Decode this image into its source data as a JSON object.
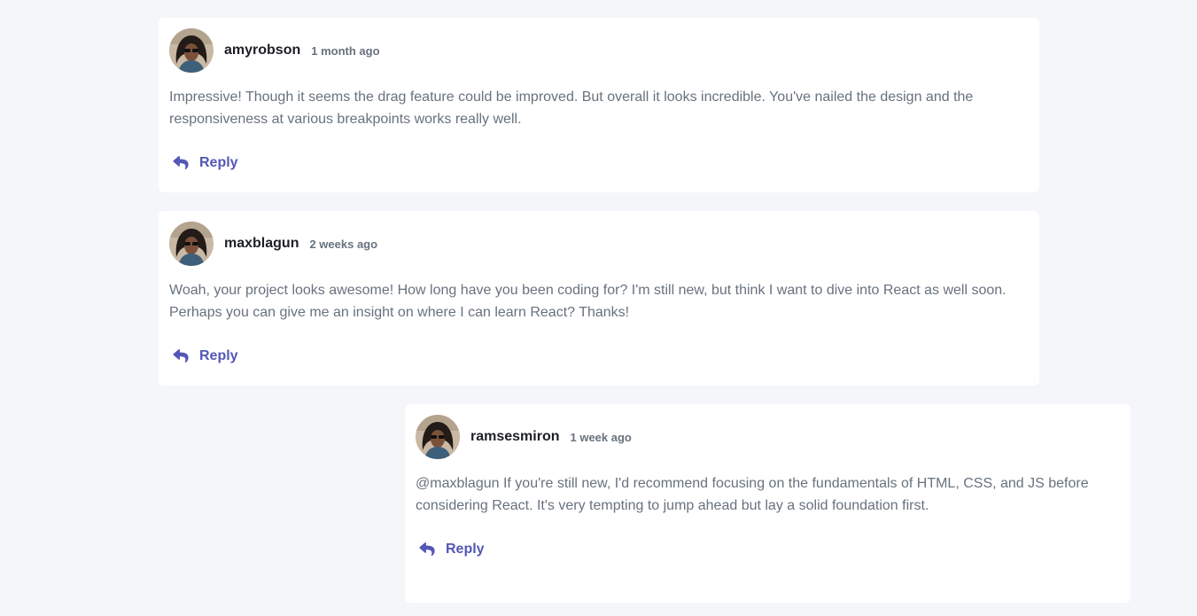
{
  "colors": {
    "page_background": "#f5f6fa",
    "card_background": "#ffffff",
    "username": "#1d1f27",
    "text": "#67727e",
    "accent": "#5357b6"
  },
  "comments": [
    {
      "username": "amyrobson",
      "timestamp": "1 month ago",
      "content": "Impressive! Though it seems the drag feature could be improved. But overall it looks incredible. You've nailed the design and the responsiveness at various breakpoints works really well.",
      "reply_label": "Reply",
      "avatar_icon": "avatar-photo-icon",
      "reply_icon": "reply-arrow-icon"
    },
    {
      "username": "maxblagun",
      "timestamp": "2 weeks ago",
      "content": "Woah, your project looks awesome! How long have you been coding for? I'm still new, but think I want to dive into React as well soon. Perhaps you can give me an insight on where I can learn React? Thanks!",
      "reply_label": "Reply",
      "avatar_icon": "avatar-photo-icon",
      "reply_icon": "reply-arrow-icon"
    },
    {
      "username": "ramsesmiron",
      "timestamp": "1 week ago",
      "content": "@maxblagun If you're still new, I'd recommend focusing on the fundamentals of HTML, CSS, and JS before considering React. It's very tempting to jump ahead but lay a solid foundation first.",
      "reply_label": "Reply",
      "avatar_icon": "avatar-photo-icon",
      "reply_icon": "reply-arrow-icon"
    }
  ]
}
